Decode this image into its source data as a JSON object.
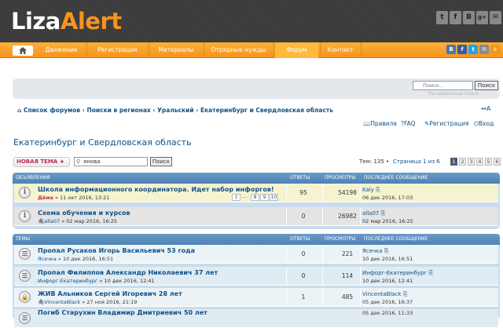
{
  "header": {
    "logo_a": "Liza",
    "logo_b": "Alert",
    "social": [
      "t",
      "f",
      "B",
      "g+",
      "✉"
    ]
  },
  "nav": {
    "items": [
      "Движение",
      "Регистрация",
      "Материалы",
      "Отрядные нужды",
      "Форум",
      "Контакт"
    ],
    "share": [
      "В",
      "f",
      "t",
      "✉",
      "+"
    ]
  },
  "search": {
    "placeholder": "Поиск...",
    "button": "Поиск",
    "advanced": "Расширенный поиск"
  },
  "breadcrumb": {
    "items": [
      "Список форумов",
      "Поиски в регионах",
      "Уральский",
      "Екатеринбург и Свердловская область"
    ],
    "sep": "‹"
  },
  "userlinks": {
    "rules": "Правила",
    "faq": "FAQ",
    "register": "Регистрация",
    "login": "Вход"
  },
  "forum": {
    "title": "Екатеринбург и Свердловская область",
    "new_topic": "НОВАЯ ТЕМА ★",
    "search_value": "янова",
    "search_button": "Поиск",
    "stats": "Тем: 135 • ",
    "page_label": "Страница 1 из 6",
    "pages": [
      "1",
      "2",
      "3",
      "4",
      "5",
      "6"
    ]
  },
  "announcements": {
    "head": "ОБЪЯВЛЕНИЯ",
    "c1": "ОТВЕТЫ",
    "c2": "ПРОСМОТРЫ",
    "c3": "ПОСЛЕДНЕЕ СООБЩЕНИЕ",
    "rows": [
      {
        "title": "Школа информационного координатора. Идет набор инфоргов!",
        "author": "Дёма",
        "date": " » 11 окт 2016, 13:21",
        "replies": "95",
        "views": "54198",
        "last_user": "Kaly",
        "last_date": "06 дек 2016, 17:03",
        "pages": [
          "1",
          "…",
          "8",
          "9",
          "10"
        ]
      },
      {
        "title": "Схема обучения и курсов",
        "author": "alla07",
        "date": " » 02 мар 2016, 16:25",
        "replies": "0",
        "views": "26982",
        "last_user": "alla07",
        "last_date": "02 мар 2016, 16:25"
      }
    ]
  },
  "topics": {
    "head": "ТЕМЫ",
    "c1": "ОТВЕТЫ",
    "c2": "ПРОСМОТРЫ",
    "c3": "ПОСЛЕДНЕЕ СООБЩЕНИЕ",
    "rows": [
      {
        "title": "Пропал Русаков Игорь Васильевич 53 года",
        "author": "Ясечка",
        "date": " » 10 дек 2016, 16:51",
        "replies": "0",
        "views": "221",
        "last_user": "Ясечка",
        "last_date": "10 дек 2016, 16:51"
      },
      {
        "title": "Пропал Филиппов Александр Николаевич 37 лет",
        "author": "Инфорг-Екатеринбург",
        "date": " » 10 дек 2016, 12:41",
        "replies": "0",
        "views": "114",
        "last_user": "Инфорг-Екатеринбург",
        "last_date": "10 дек 2016, 12:41"
      },
      {
        "title": "ЖИВ Альников Сергей Игоревич 28 лет",
        "author": "VincentaBlack",
        "date": " » 27 ноя 2016, 21:19",
        "replies": "1",
        "views": "485",
        "last_user": "VincentaBlack",
        "last_date": "05 дек 2016, 16:37"
      },
      {
        "title": "Погиб Старухин Владимир Дмитриевич 50 лет",
        "author": "",
        "date": "",
        "replies": "",
        "views": "",
        "last_user": "",
        "last_date": "05 дек 2016, 11:33"
      }
    ]
  }
}
